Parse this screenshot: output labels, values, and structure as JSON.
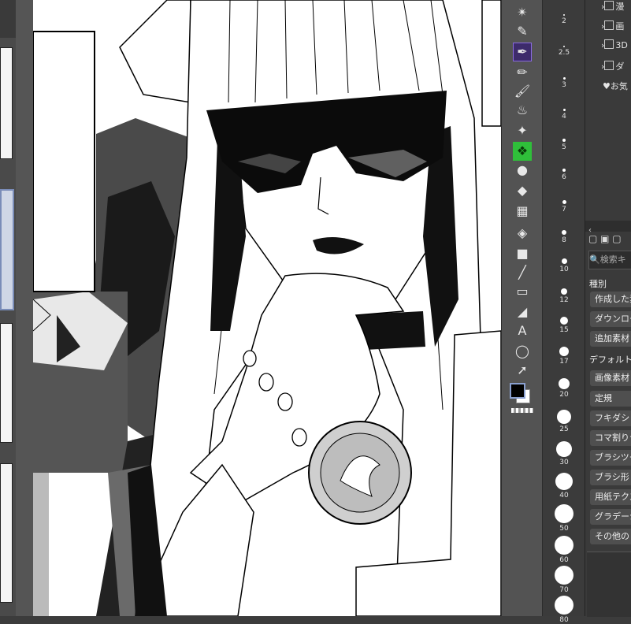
{
  "tool_icons": [
    "star-sparkle-icon",
    "eyedropper-icon",
    "pen-icon",
    "pencil-icon",
    "brush-icon",
    "airbrush-icon",
    "sparkle-icon",
    "decoration-icon",
    "blend-icon",
    "eraser-icon",
    "mesh-icon",
    "fill-icon",
    "gradient-icon",
    "line-icon",
    "frame-icon",
    "ruler-icon",
    "text-icon",
    "lasso-icon",
    "select-arrow-icon"
  ],
  "brush_sizes": [
    "2",
    "2.5",
    "3",
    "4",
    "5",
    "6",
    "7",
    "8",
    "10",
    "12",
    "15",
    "17",
    "20",
    "25",
    "30",
    "40",
    "50",
    "60",
    "70",
    "80"
  ],
  "material_tree": [
    {
      "label": "漫"
    },
    {
      "label": "画"
    },
    {
      "label": "3D"
    },
    {
      "label": "ダ"
    },
    {
      "label": "お気"
    }
  ],
  "material_search": {
    "placeholder": "検索キ"
  },
  "material_section_type": "種別",
  "material_type_buttons": [
    "作成した素",
    "ダウンロー",
    "追加素材"
  ],
  "material_section_default": "デフォルトタ",
  "material_default_buttons": [
    "画像素材",
    "定規",
    "フキダシ",
    "コマ割りテ",
    "ブラシツー",
    "ブラシ形",
    "用紙テクス",
    "グラデーシ",
    "その他の"
  ],
  "colors": {
    "main": "#000000",
    "sub": "#ffffff",
    "accent": "#8a6ae0"
  }
}
